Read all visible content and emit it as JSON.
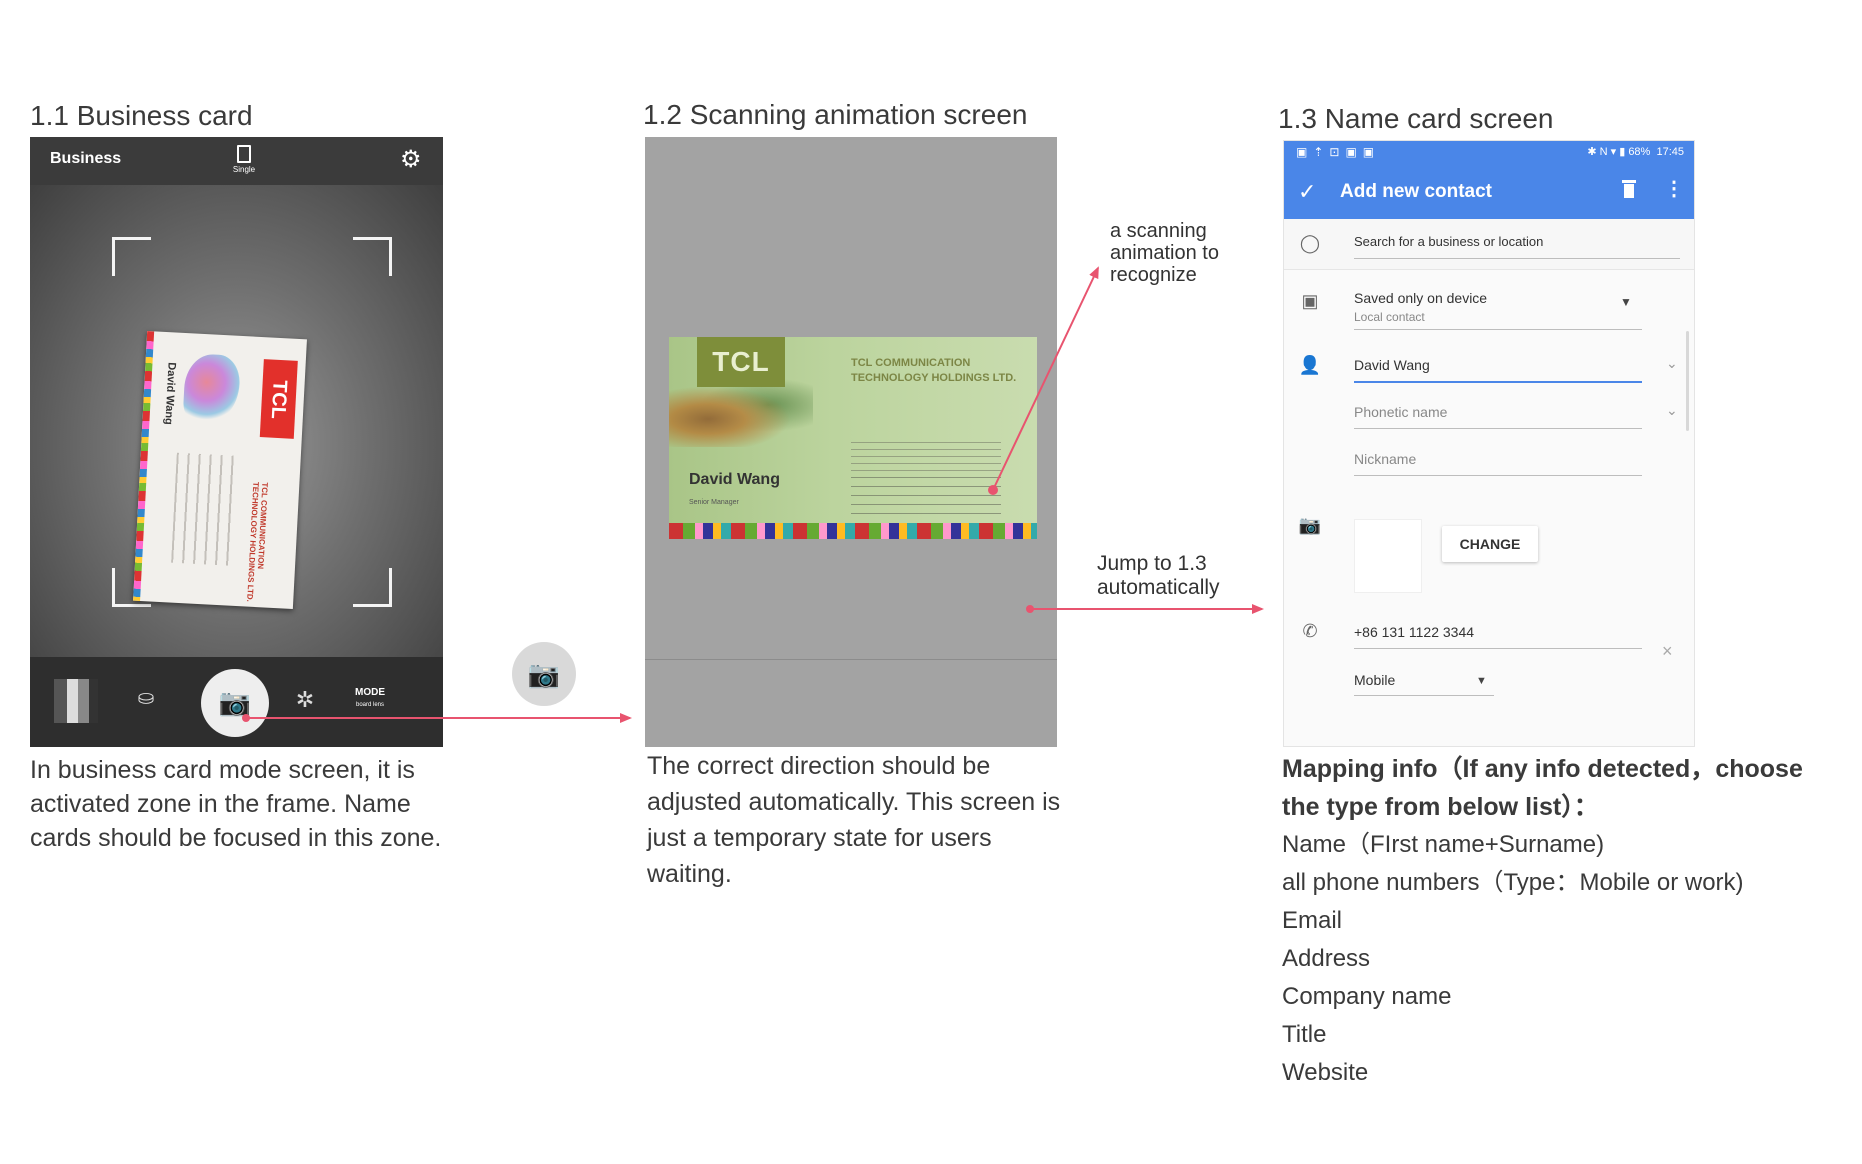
{
  "section1": {
    "heading": "1.1 Business card",
    "topbar": {
      "mode_label": "Business",
      "single_label": "Single",
      "settings_icon": "gear-icon"
    },
    "bottombar": {
      "mode_label": "MODE",
      "mode_sub": "board lens"
    },
    "card": {
      "name": "David Wang",
      "logo": "TCL",
      "company": "TCL COMMUNICATION TECHNOLOGY HOLDINGS LTD."
    },
    "description": "In business card mode screen, it is activated zone in the frame. Name cards should be focused in this zone."
  },
  "section2": {
    "heading": "1.2 Scanning animation screen",
    "card": {
      "logo": "TCL",
      "company_line1": "TCL COMMUNICATION",
      "company_line2": "TECHNOLOGY HOLDINGS LTD.",
      "name": "David Wang",
      "role": "Senior Manager"
    },
    "description": "The correct direction should be adjusted automatically. This screen is just a temporary state for users waiting."
  },
  "annotations": {
    "scan_note": [
      "a scanning",
      "animation to",
      "recognize"
    ],
    "jump_note": [
      "Jump to 1.3",
      "automatically"
    ],
    "arrow_color": "#e8546f"
  },
  "section3": {
    "heading": "1.3 Name card screen",
    "status_bar": {
      "battery": "68%",
      "time": "17:45"
    },
    "app_bar": {
      "title": "Add new contact"
    },
    "search_placeholder": "Search for a business or location",
    "account": {
      "primary": "Saved only on device",
      "secondary": "Local contact"
    },
    "name_value": "David Wang",
    "phonetic_placeholder": "Phonetic name",
    "nickname_placeholder": "Nickname",
    "change_button": "CHANGE",
    "phone_value": "+86 131 1122 3344",
    "phone_type": "Mobile",
    "accent_color": "#4a86e8"
  },
  "mapping": {
    "title_line1": "Mapping info（If any info detected，choose",
    "title_line2": "the type from below list）：",
    "items": [
      "Name（FIrst name+Surname)",
      "all phone numbers（Type：Mobile or work)",
      "Email",
      "Address",
      "Company name",
      "Title",
      "Website"
    ]
  }
}
